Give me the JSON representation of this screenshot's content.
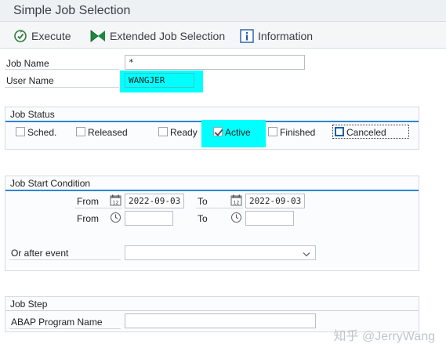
{
  "window": {
    "title": "Simple Job Selection"
  },
  "toolbar": {
    "execute": "Execute",
    "extended": "Extended Job Selection",
    "information": "Information"
  },
  "header_fields": {
    "job_name_label": "Job Name",
    "job_name_value": "*",
    "user_name_label": "User Name",
    "user_name_value": "WANGJER"
  },
  "job_status": {
    "title": "Job Status",
    "items": [
      {
        "label": "Sched.",
        "checked": false
      },
      {
        "label": "Released",
        "checked": false
      },
      {
        "label": "Ready",
        "checked": false
      },
      {
        "label": "Active",
        "checked": true
      },
      {
        "label": "Finished",
        "checked": false
      },
      {
        "label": "Canceled",
        "checked": false
      }
    ]
  },
  "start_condition": {
    "title": "Job Start Condition",
    "from_label": "From",
    "to_label": "To",
    "from_date": "2022-09-03",
    "to_date": "2022-09-03",
    "from_time": "",
    "to_time": "",
    "after_event_label": "Or after event",
    "after_event_value": ""
  },
  "job_step": {
    "title": "Job Step",
    "abap_label": "ABAP Program Name",
    "abap_value": ""
  },
  "watermark": "知乎 @JerryWang",
  "colors": {
    "highlight": "#00ffff",
    "section_line": "#2a86d1",
    "execute_icon": "#2f7d3a",
    "extended_icon": "#1b8a3c",
    "info_icon": "#1f5fa8"
  }
}
